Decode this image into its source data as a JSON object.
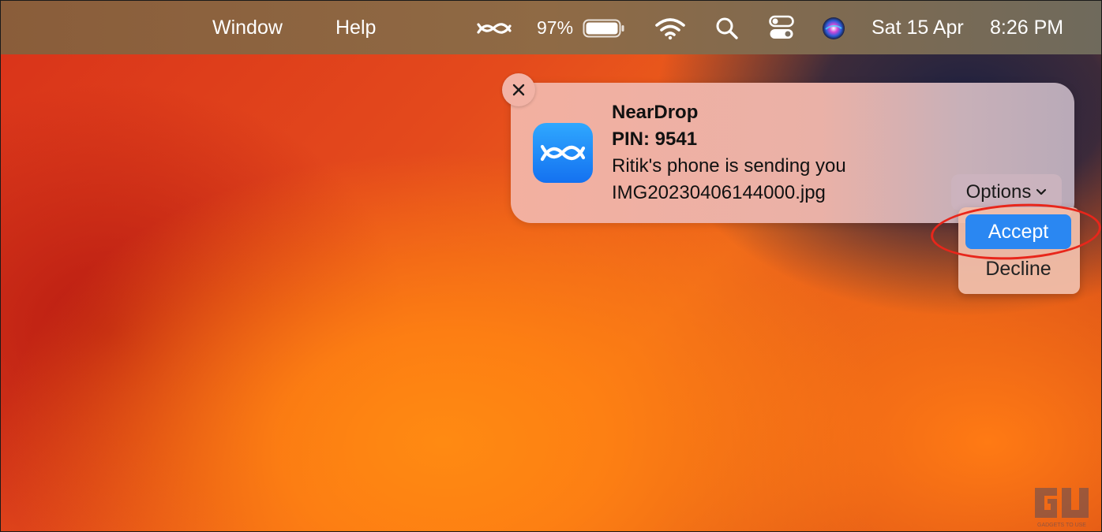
{
  "menubar": {
    "window": "Window",
    "help": "Help",
    "battery_percent": "97%",
    "date": "Sat 15 Apr",
    "time": "8:26 PM",
    "icons": [
      "neardrop-icon",
      "battery-icon",
      "wifi-icon",
      "search-icon",
      "control-center-icon",
      "siri-icon"
    ]
  },
  "notification": {
    "app_name": "NearDrop",
    "pin": "PIN: 9541",
    "message": "Ritik's phone is sending you",
    "filename": "IMG20230406144000.jpg",
    "options_label": "Options",
    "menu": {
      "accept": "Accept",
      "decline": "Decline"
    }
  },
  "colors": {
    "accent_button": "#2a87f2",
    "highlight_ring": "#e8261b",
    "app_icon": "#1a8cff"
  }
}
